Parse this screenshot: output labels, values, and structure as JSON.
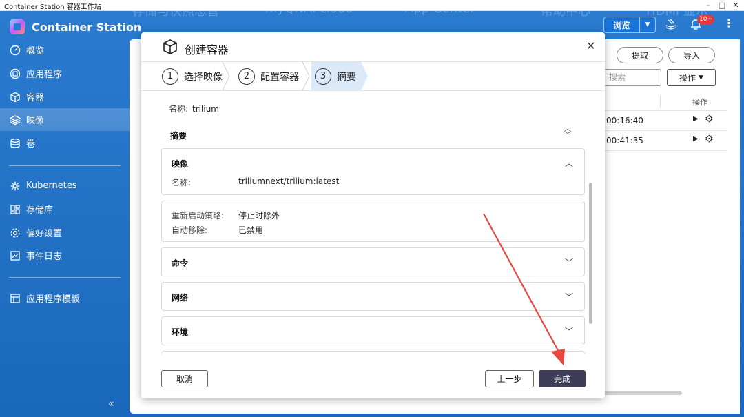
{
  "window": {
    "title": "Container Station 容器工作站",
    "controls": [
      "–",
      "□",
      "✕"
    ]
  },
  "ghost_menu": [
    "存储与快照总管",
    "myQNAPcloud",
    "App Center",
    "帮助中心",
    "HDMI 显示"
  ],
  "app": {
    "name": "Container Station"
  },
  "sidebar": {
    "items": [
      {
        "label": "概览",
        "icon": "dashboard-icon"
      },
      {
        "label": "应用程序",
        "icon": "apps-icon"
      },
      {
        "label": "容器",
        "icon": "cube-icon"
      },
      {
        "label": "映像",
        "icon": "layers-icon",
        "active": true
      },
      {
        "label": "卷",
        "icon": "database-icon"
      },
      {
        "label": "Kubernetes",
        "icon": "kubernetes-icon"
      },
      {
        "label": "存储库",
        "icon": "grid-icon"
      },
      {
        "label": "偏好设置",
        "icon": "settings-icon"
      },
      {
        "label": "事件日志",
        "icon": "log-icon"
      },
      {
        "label": "应用程序模板",
        "icon": "template-icon"
      }
    ],
    "collapse": "«"
  },
  "topbar": {
    "browse_label": "浏览",
    "badge": "10+"
  },
  "background": {
    "pull_label": "提取",
    "import_label": "导入",
    "search_placeholder": "搜索",
    "ops_label": "操作",
    "column_ops": "操作",
    "rows": [
      {
        "time": "00:16:40"
      },
      {
        "time": "00:41:35"
      }
    ]
  },
  "modal": {
    "title": "创建容器",
    "steps": [
      {
        "num": "1",
        "label": "选择映像"
      },
      {
        "num": "2",
        "label": "配置容器"
      },
      {
        "num": "3",
        "label": "摘要",
        "active": true
      }
    ],
    "name_label": "名称:",
    "name_value": "trilium",
    "summary_label": "摘要",
    "sections": {
      "image": {
        "title": "映像",
        "fields": [
          {
            "key": "名称:",
            "value": "triliumnext/trilium:latest"
          }
        ]
      },
      "policy": {
        "fields": [
          {
            "key": "重新启动策略:",
            "value": "停止时除外"
          },
          {
            "key": "自动移除:",
            "value": "已禁用"
          }
        ]
      },
      "command": {
        "title": "命令"
      },
      "network": {
        "title": "网络"
      },
      "env": {
        "title": "环境"
      }
    },
    "cancel_label": "取消",
    "prev_label": "上一步",
    "finish_label": "完成"
  },
  "colors": {
    "sidebar_bg": "#1f6fc0",
    "active_step": "#dbe9f8",
    "primary_button": "#3d3d58",
    "annotation_arrow": "#e8473f"
  }
}
